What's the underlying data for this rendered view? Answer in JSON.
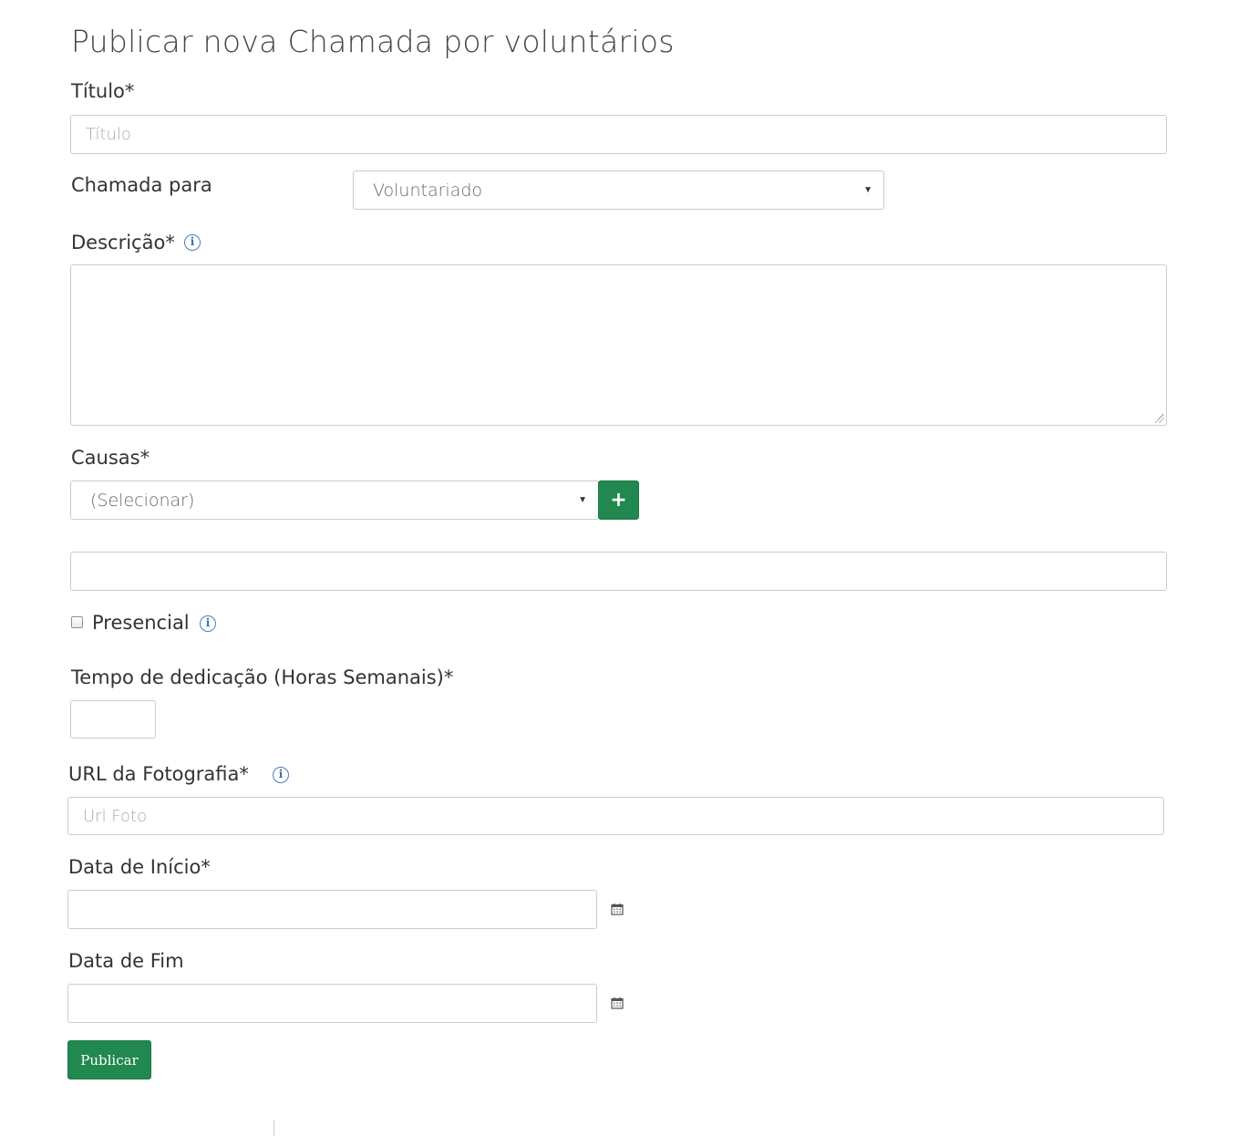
{
  "page": {
    "title": "Publicar nova Chamada por voluntários"
  },
  "form": {
    "titulo": {
      "label": "Título*",
      "placeholder": "Título",
      "value": ""
    },
    "chamada_para": {
      "label": "Chamada para",
      "selected": "Voluntariado"
    },
    "descricao": {
      "label": "Descrição*",
      "value": ""
    },
    "causas": {
      "label": "Causas*",
      "selected": "(Selecionar)",
      "add_button_label": "+",
      "selected_causes_value": ""
    },
    "presencial": {
      "label": "Presencial",
      "checked": false
    },
    "tempo_dedicacao": {
      "label": "Tempo de dedicação (Horas Semanais)*",
      "value": ""
    },
    "url_fotografia": {
      "label": "URL da Fotografia*",
      "placeholder": "Url Foto",
      "value": ""
    },
    "data_inicio": {
      "label": "Data de Início*",
      "value": ""
    },
    "data_fim": {
      "label": "Data de Fim",
      "value": ""
    },
    "submit_label": "Publicar"
  },
  "icons": {
    "info": "info-circle-icon",
    "calendar": "calendar-icon",
    "plus": "plus-icon",
    "caret": "caret-down-icon"
  },
  "colors": {
    "primary_green": "#21884f",
    "info_blue": "#3a6fb0",
    "border": "#cccccc"
  }
}
